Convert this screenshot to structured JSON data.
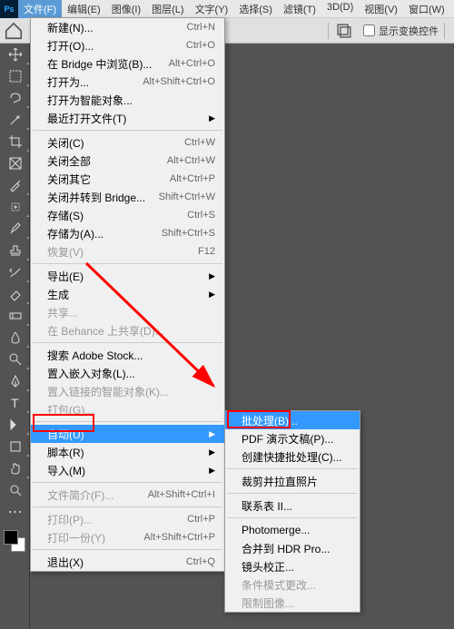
{
  "menubar": {
    "items": [
      "文件(F)",
      "编辑(E)",
      "图像(I)",
      "图层(L)",
      "文字(Y)",
      "选择(S)",
      "滤镜(T)",
      "3D(D)",
      "视图(V)",
      "窗口(W)"
    ],
    "active_index": 0
  },
  "toolbar": {
    "transform_checkbox_label": "显示变换控件"
  },
  "dropdown_main": [
    {
      "type": "item",
      "label": "新建(N)...",
      "shortcut": "Ctrl+N"
    },
    {
      "type": "item",
      "label": "打开(O)...",
      "shortcut": "Ctrl+O"
    },
    {
      "type": "item",
      "label": "在 Bridge 中浏览(B)...",
      "shortcut": "Alt+Ctrl+O"
    },
    {
      "type": "item",
      "label": "打开为...",
      "shortcut": "Alt+Shift+Ctrl+O"
    },
    {
      "type": "item",
      "label": "打开为智能对象..."
    },
    {
      "type": "item",
      "label": "最近打开文件(T)",
      "submenu": true
    },
    {
      "type": "sep"
    },
    {
      "type": "item",
      "label": "关闭(C)",
      "shortcut": "Ctrl+W"
    },
    {
      "type": "item",
      "label": "关闭全部",
      "shortcut": "Alt+Ctrl+W"
    },
    {
      "type": "item",
      "label": "关闭其它",
      "shortcut": "Alt+Ctrl+P"
    },
    {
      "type": "item",
      "label": "关闭并转到 Bridge...",
      "shortcut": "Shift+Ctrl+W"
    },
    {
      "type": "item",
      "label": "存储(S)",
      "shortcut": "Ctrl+S"
    },
    {
      "type": "item",
      "label": "存储为(A)...",
      "shortcut": "Shift+Ctrl+S"
    },
    {
      "type": "item",
      "label": "恢复(V)",
      "shortcut": "F12",
      "disabled": true
    },
    {
      "type": "sep"
    },
    {
      "type": "item",
      "label": "导出(E)",
      "submenu": true
    },
    {
      "type": "item",
      "label": "生成",
      "submenu": true
    },
    {
      "type": "item",
      "label": "共享...",
      "disabled": true
    },
    {
      "type": "item",
      "label": "在 Behance 上共享(D)...",
      "disabled": true
    },
    {
      "type": "sep"
    },
    {
      "type": "item",
      "label": "搜索 Adobe Stock..."
    },
    {
      "type": "item",
      "label": "置入嵌入对象(L)..."
    },
    {
      "type": "item",
      "label": "置入链接的智能对象(K)...",
      "disabled": true
    },
    {
      "type": "item",
      "label": "打包(G)...",
      "disabled": true
    },
    {
      "type": "sep"
    },
    {
      "type": "item",
      "label": "自动(U)",
      "submenu": true,
      "highlighted": true
    },
    {
      "type": "item",
      "label": "脚本(R)",
      "submenu": true
    },
    {
      "type": "item",
      "label": "导入(M)",
      "submenu": true
    },
    {
      "type": "sep"
    },
    {
      "type": "item",
      "label": "文件简介(F)...",
      "shortcut": "Alt+Shift+Ctrl+I",
      "disabled": true
    },
    {
      "type": "sep"
    },
    {
      "type": "item",
      "label": "打印(P)...",
      "shortcut": "Ctrl+P",
      "disabled": true
    },
    {
      "type": "item",
      "label": "打印一份(Y)",
      "shortcut": "Alt+Shift+Ctrl+P",
      "disabled": true
    },
    {
      "type": "sep"
    },
    {
      "type": "item",
      "label": "退出(X)",
      "shortcut": "Ctrl+Q"
    }
  ],
  "dropdown_sub": [
    {
      "type": "item",
      "label": "批处理(B)...",
      "highlighted": true
    },
    {
      "type": "item",
      "label": "PDF 演示文稿(P)..."
    },
    {
      "type": "item",
      "label": "创建快捷批处理(C)..."
    },
    {
      "type": "sep"
    },
    {
      "type": "item",
      "label": "裁剪并拉直照片"
    },
    {
      "type": "sep"
    },
    {
      "type": "item",
      "label": "联系表 II..."
    },
    {
      "type": "sep"
    },
    {
      "type": "item",
      "label": "Photomerge..."
    },
    {
      "type": "item",
      "label": "合并到 HDR Pro..."
    },
    {
      "type": "item",
      "label": "镜头校正..."
    },
    {
      "type": "item",
      "label": "条件模式更改...",
      "disabled": true
    },
    {
      "type": "item",
      "label": "限制图像...",
      "disabled": true
    }
  ]
}
